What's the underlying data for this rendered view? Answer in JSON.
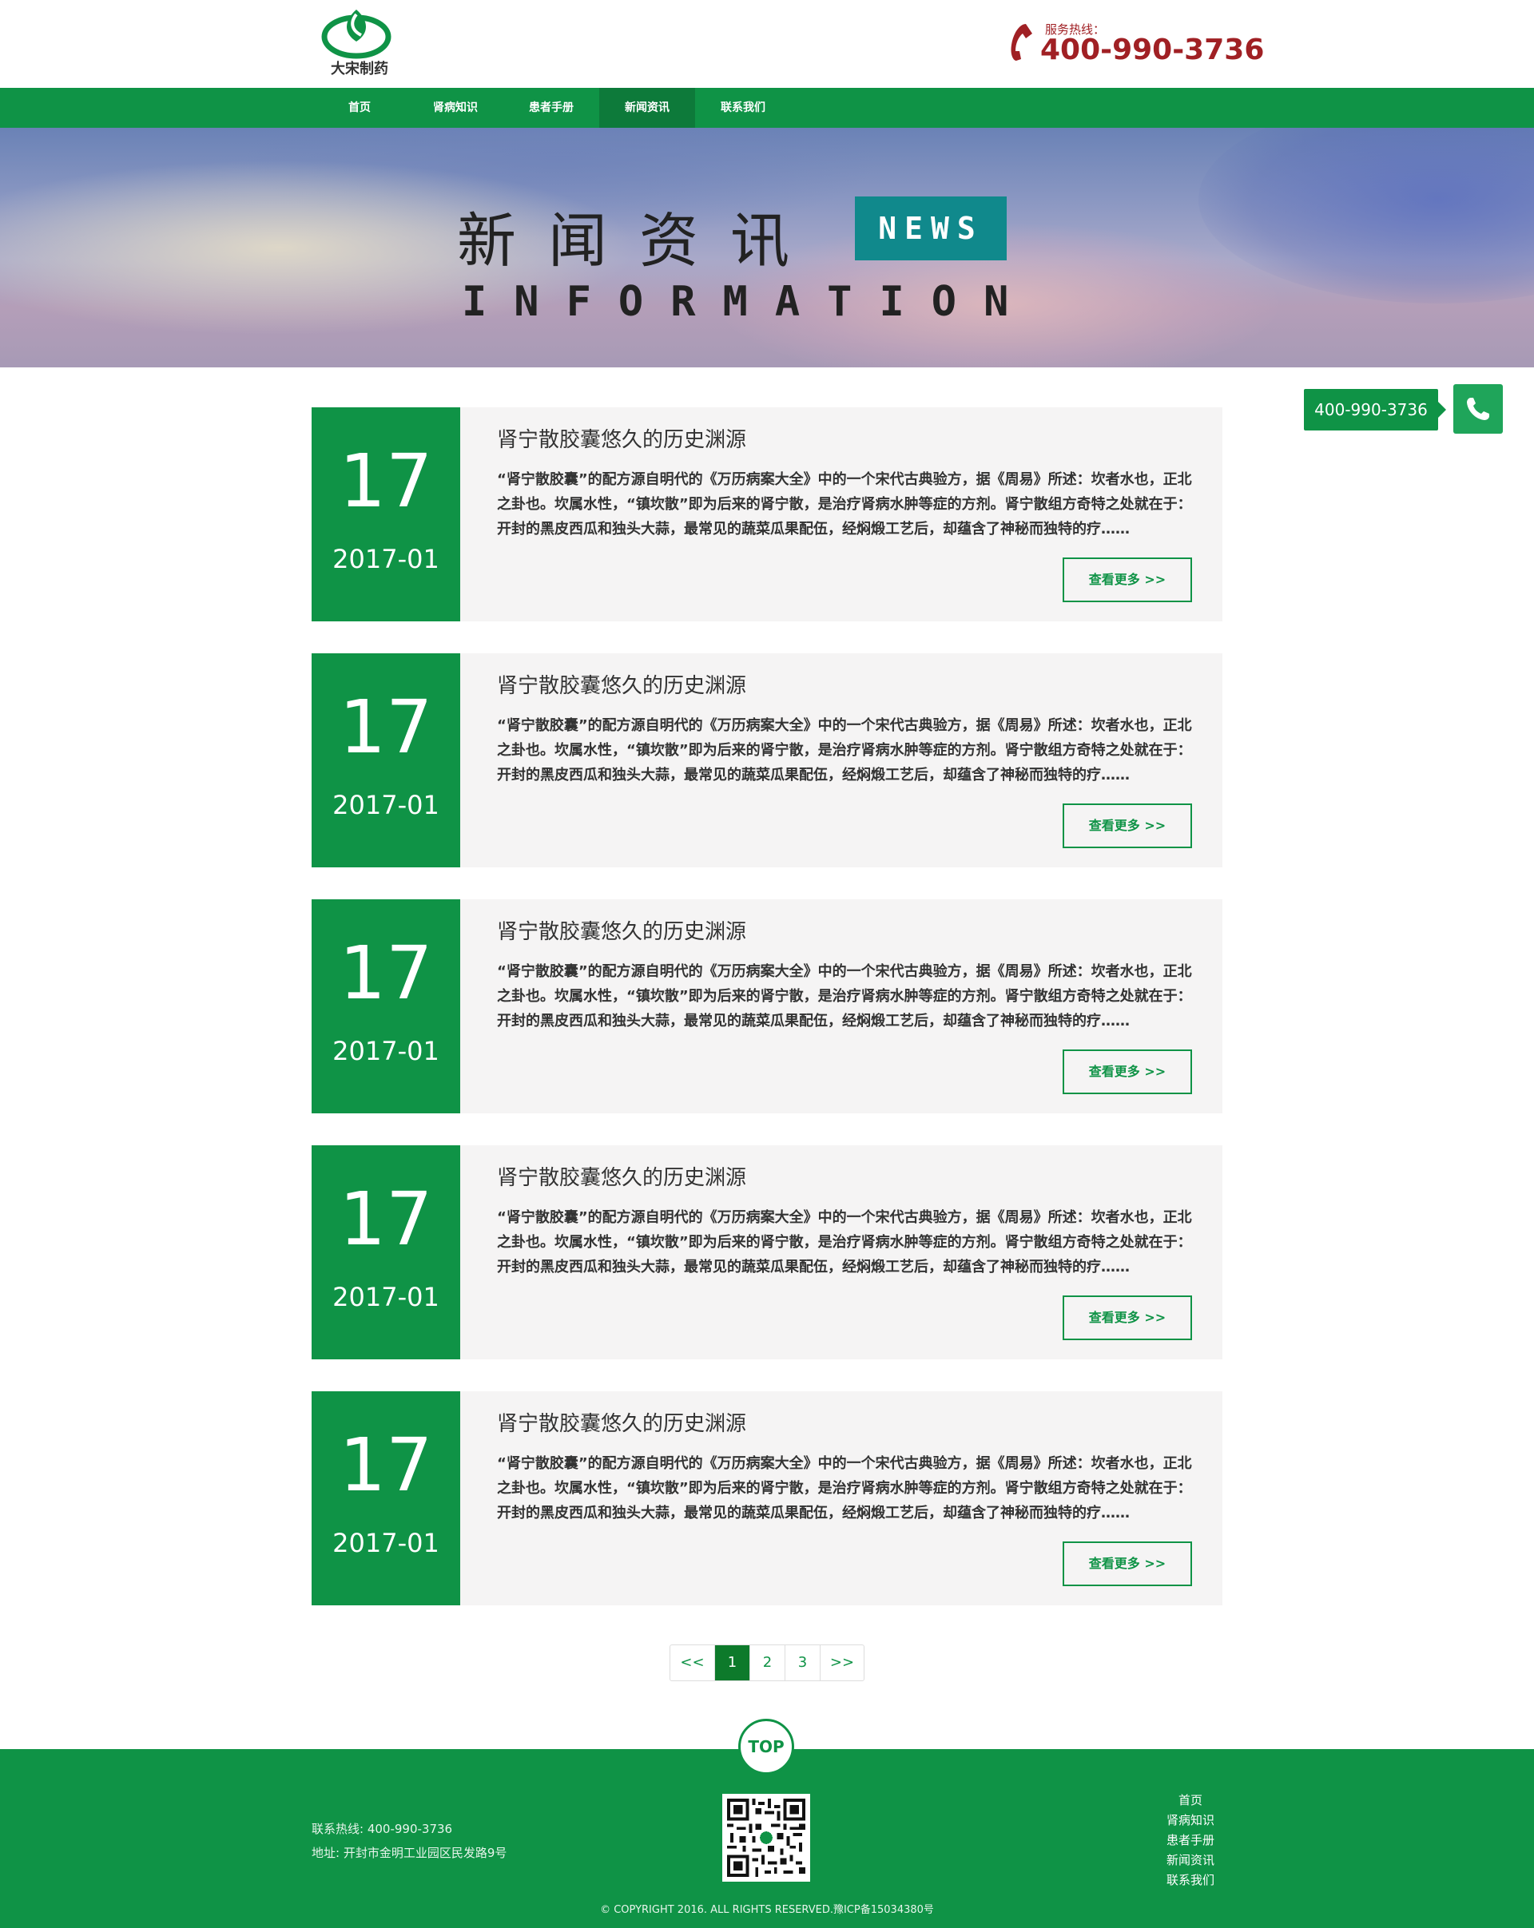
{
  "brand": {
    "name": "大宋制药",
    "hotline_label": "服务热线：",
    "hotline_number": "400-990-3736",
    "accent_color": "#0f9346",
    "hotline_color": "#a02024"
  },
  "nav": {
    "items": [
      {
        "label": "首页",
        "active": false
      },
      {
        "label": "肾病知识",
        "active": false
      },
      {
        "label": "患者手册",
        "active": false
      },
      {
        "label": "新闻资讯",
        "active": true
      },
      {
        "label": "联系我们",
        "active": false
      }
    ]
  },
  "banner": {
    "title": "新闻资讯",
    "badge": "NEWS",
    "subtitle": "INFORMATION"
  },
  "float_contact": {
    "phone": "400-990-3736",
    "icon": "phone-icon"
  },
  "news": [
    {
      "day": "17",
      "year_month": "2017-01",
      "title": "肾宁散胶囊悠久的历史渊源",
      "summary": "“肾宁散胶囊”的配方源自明代的《万历病案大全》中的一个宋代古典验方，据《周易》所述：坎者水也，正北之卦也。坎属水性，“镇坎散”即为后来的肾宁散，是治疗肾病水肿等症的方剂。肾宁散组方奇特之处就在于：开封的黑皮西瓜和独头大蒜，最常见的蔬菜瓜果配伍，经焖煅工艺后，却蕴含了神秘而独特的疗……",
      "more": "查看更多 >>"
    },
    {
      "day": "17",
      "year_month": "2017-01",
      "title": "肾宁散胶囊悠久的历史渊源",
      "summary": "“肾宁散胶囊”的配方源自明代的《万历病案大全》中的一个宋代古典验方，据《周易》所述：坎者水也，正北之卦也。坎属水性，“镇坎散”即为后来的肾宁散，是治疗肾病水肿等症的方剂。肾宁散组方奇特之处就在于：开封的黑皮西瓜和独头大蒜，最常见的蔬菜瓜果配伍，经焖煅工艺后，却蕴含了神秘而独特的疗……",
      "more": "查看更多 >>"
    },
    {
      "day": "17",
      "year_month": "2017-01",
      "title": "肾宁散胶囊悠久的历史渊源",
      "summary": "“肾宁散胶囊”的配方源自明代的《万历病案大全》中的一个宋代古典验方，据《周易》所述：坎者水也，正北之卦也。坎属水性，“镇坎散”即为后来的肾宁散，是治疗肾病水肿等症的方剂。肾宁散组方奇特之处就在于：开封的黑皮西瓜和独头大蒜，最常见的蔬菜瓜果配伍，经焖煅工艺后，却蕴含了神秘而独特的疗……",
      "more": "查看更多 >>"
    },
    {
      "day": "17",
      "year_month": "2017-01",
      "title": "肾宁散胶囊悠久的历史渊源",
      "summary": "“肾宁散胶囊”的配方源自明代的《万历病案大全》中的一个宋代古典验方，据《周易》所述：坎者水也，正北之卦也。坎属水性，“镇坎散”即为后来的肾宁散，是治疗肾病水肿等症的方剂。肾宁散组方奇特之处就在于：开封的黑皮西瓜和独头大蒜，最常见的蔬菜瓜果配伍，经焖煅工艺后，却蕴含了神秘而独特的疗……",
      "more": "查看更多 >>"
    },
    {
      "day": "17",
      "year_month": "2017-01",
      "title": "肾宁散胶囊悠久的历史渊源",
      "summary": "“肾宁散胶囊”的配方源自明代的《万历病案大全》中的一个宋代古典验方，据《周易》所述：坎者水也，正北之卦也。坎属水性，“镇坎散”即为后来的肾宁散，是治疗肾病水肿等症的方剂。肾宁散组方奇特之处就在于：开封的黑皮西瓜和独头大蒜，最常见的蔬菜瓜果配伍，经焖煅工艺后，却蕴含了神秘而独特的疗……",
      "more": "查看更多 >>"
    }
  ],
  "pagination": {
    "prev": "<<",
    "pages": [
      "1",
      "2",
      "3"
    ],
    "current": "1",
    "next": ">>"
  },
  "footer": {
    "top_button": "TOP",
    "hotline": "联系热线: 400-990-3736",
    "address": "地址: 开封市金明工业园区民发路9号",
    "links": [
      "首页",
      "肾病知识",
      "患者手册",
      "新闻资讯",
      "联系我们"
    ],
    "copyright": "© COPYRIGHT 2016. ALL RIGHTS RESERVED.豫ICP备15034380号"
  }
}
